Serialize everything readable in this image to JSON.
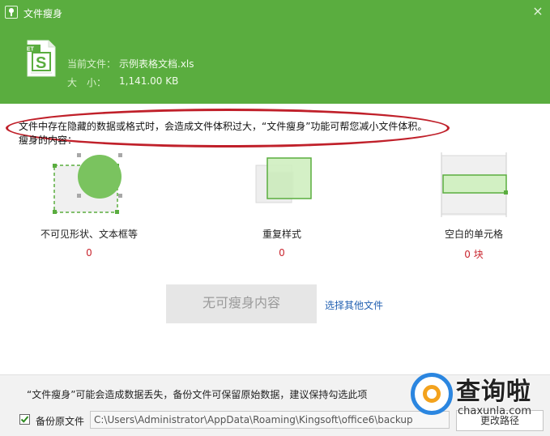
{
  "window": {
    "title": "文件瘦身",
    "close_glyph": "×"
  },
  "file": {
    "icon_badge": "ET",
    "icon_letter": "S",
    "current_label": "当前文件：",
    "current_name": "示例表格文档.xls",
    "size_label": "大　小：",
    "size_value": "1,141.00 KB"
  },
  "notice": {
    "text": "文件中存在隐藏的数据或格式时，会造成文件体积过大，“文件瘦身”功能可帮您减小文件体积。",
    "content_label": "瘦身的内容："
  },
  "categories": [
    {
      "label": "不可见形状、文本框等",
      "count": "0"
    },
    {
      "label": "重复样式",
      "count": "0"
    },
    {
      "label": "空白的单元格",
      "count": "0 块"
    }
  ],
  "actions": {
    "main_button": "无可瘦身内容",
    "link": "选择其他文件"
  },
  "footer": {
    "warning": "“文件瘦身”可能会造成数据丢失，备份文件可保留原始数据，建议保持勾选此项",
    "backup_checked": true,
    "backup_label": "备份原文件",
    "backup_path": "C:\\Users\\Administrator\\AppData\\Roaming\\Kingsoft\\office6\\backup",
    "change_button": "更改路径"
  },
  "watermark": {
    "text": "查询啦",
    "domain": "chaxunla.com"
  },
  "colors": {
    "header": "#5aad3f",
    "highlight": "#c0202a",
    "count": "#c9262f",
    "link": "#2361b2"
  }
}
